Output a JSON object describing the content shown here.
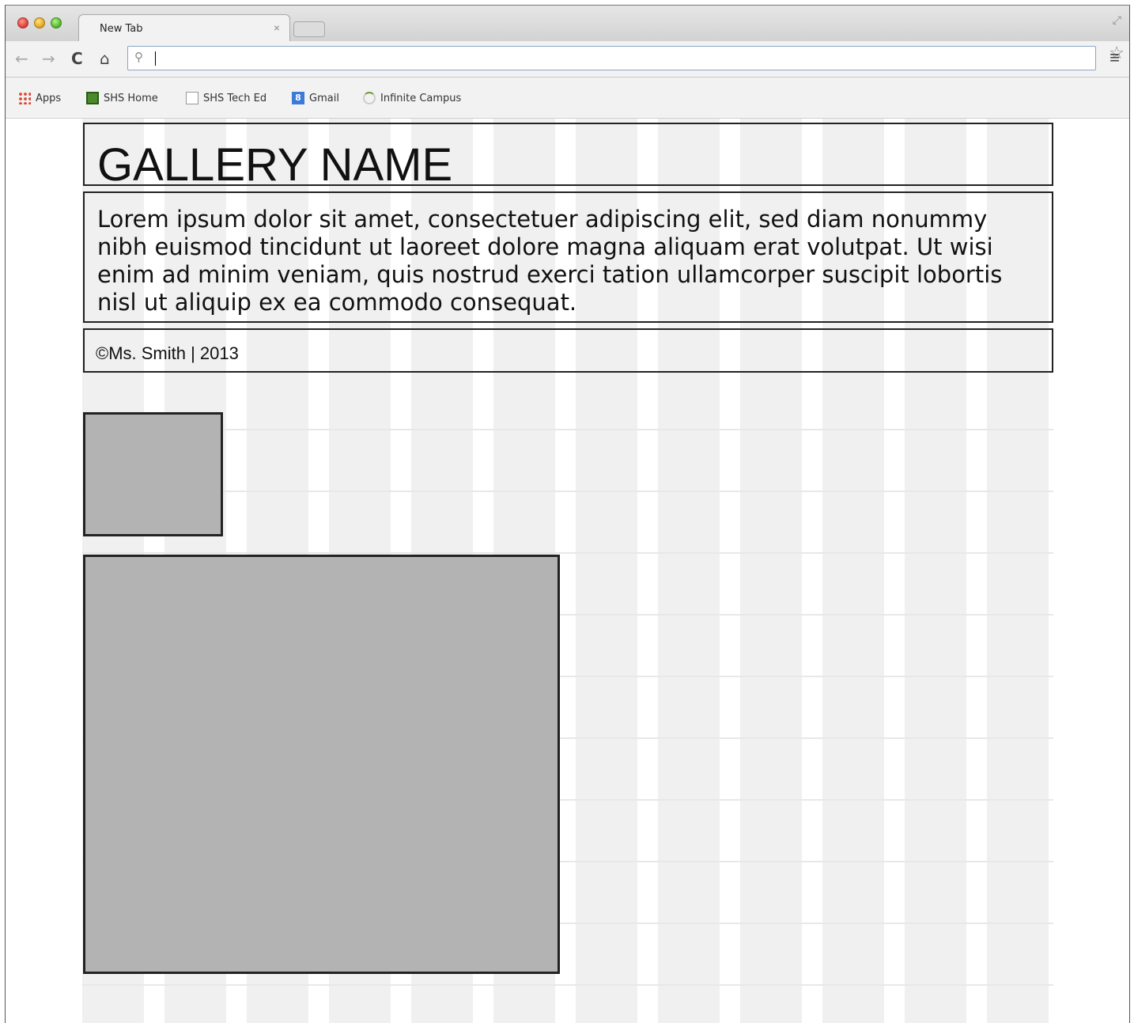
{
  "browser": {
    "tab_title": "New Tab",
    "tab_close": "×",
    "omnibox_value": "",
    "bookmarks": [
      {
        "label": "Apps",
        "icon": "apps-grid-icon"
      },
      {
        "label": "SHS Home",
        "icon": "site-favicon-icon"
      },
      {
        "label": "SHS Tech Ed",
        "icon": "document-icon"
      },
      {
        "label": "Gmail",
        "icon": "google-icon"
      },
      {
        "label": "Infinite Campus",
        "icon": "loading-spinner-icon"
      }
    ]
  },
  "page": {
    "gallery_name": "GALLERY NAME",
    "description": "Lorem ipsum dolor sit amet, consectetuer adipiscing elit, sed diam nonummy nibh euismod tincidunt ut laoreet dolore magna aliquam erat volutpat. Ut wisi enim ad minim veniam, quis nostrud exerci tation ullamcorper suscipit lobortis nisl ut aliquip ex ea commodo consequat.",
    "footer": "©Ms. Smith | 2013"
  },
  "colors": {
    "placeholder_gray": "#b3b3b3",
    "grid_column": "#f0f0f0",
    "border": "#222222"
  }
}
